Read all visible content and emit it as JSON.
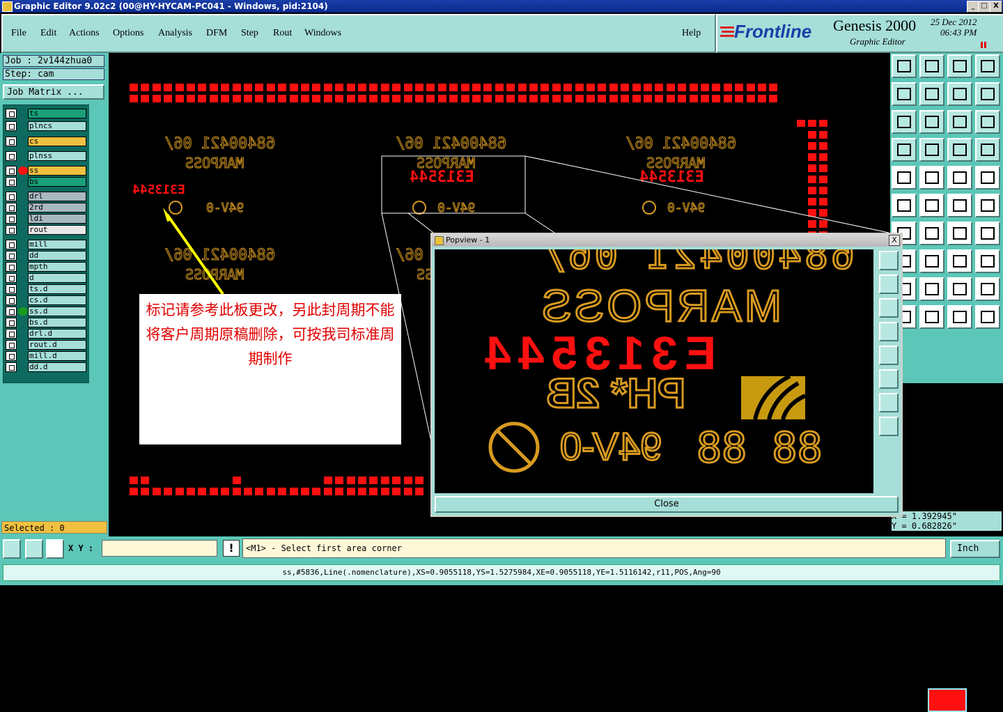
{
  "window": {
    "title": "Graphic Editor 9.02c2 (00@HY-HYCAM-PC041 - Windows, pid:2104)",
    "min_label": "_",
    "restore_label": "□",
    "close_label": "X"
  },
  "menu": {
    "items": [
      "File",
      "Edit",
      "Actions",
      "Options",
      "Analysis",
      "DFM",
      "Step",
      "Rout",
      "Windows"
    ],
    "help": "Help"
  },
  "brand": {
    "logo": "Frontline",
    "product": "Genesis 2000",
    "subtitle": "Graphic Editor",
    "date": "25 Dec 2012",
    "time": "06:43 PM"
  },
  "job": {
    "job_label": "Job : 2v144zhua0",
    "step_label": "Step: cam",
    "matrix_button": "Job Matrix ..."
  },
  "layers": [
    {
      "name": "ts",
      "color": "#1aa07a"
    },
    {
      "name": "plncs",
      "color": "#a6ded8"
    },
    {
      "name": "cs",
      "color": "#f0c040"
    },
    {
      "name": "plnss",
      "color": "#a6ded8"
    },
    {
      "name": "ss",
      "color": "#f0c040",
      "active": true
    },
    {
      "name": "bs",
      "color": "#1aa07a"
    },
    {
      "name": "drl",
      "color": "#a8b8c0"
    },
    {
      "name": "2rd",
      "color": "#a8b8c0"
    },
    {
      "name": "ldi",
      "color": "#a8b8c0"
    },
    {
      "name": "rout",
      "color": "#e8e8e8"
    },
    {
      "name": "mill",
      "color": "#a6ded8"
    },
    {
      "name": "dd",
      "color": "#a6ded8"
    },
    {
      "name": "mpth",
      "color": "#a6ded8"
    },
    {
      "name": "d",
      "color": "#a6ded8"
    },
    {
      "name": "ts.d",
      "color": "#a6ded8"
    },
    {
      "name": "cs.d",
      "color": "#a6ded8"
    },
    {
      "name": "ss.d",
      "color": "#a6ded8",
      "green": true
    },
    {
      "name": "bs.d",
      "color": "#a6ded8"
    },
    {
      "name": "drl.d",
      "color": "#a6ded8"
    },
    {
      "name": "rout.d",
      "color": "#a6ded8"
    },
    {
      "name": "mill.d",
      "color": "#a6ded8"
    },
    {
      "name": "dd.d",
      "color": "#a6ded8"
    }
  ],
  "selected": "Selected : 0",
  "canvas": {
    "part_number": "68400421 06/",
    "brand_text": "MARPOSS",
    "code": "E313544",
    "ph_text": "PH* 2B",
    "rating": "94V-0",
    "date_code": "88 88",
    "note": "标记请参考此板更改，另此封周期不能将客户周期原稿删除，可按我司标准周期制作"
  },
  "popview": {
    "title": "Popview - 1",
    "close_label": "Close",
    "x_label": "X"
  },
  "coords": {
    "x": "X = 1.392945\"",
    "y": "Y = 0.682826\""
  },
  "bottom": {
    "xy_label": "X Y :",
    "xy_value": "",
    "excl": "!",
    "prompt": "<M1> - Select first area corner",
    "units": "Inch"
  },
  "status": "ss,#5836,Line(.nomenclature),XS=0.9055118,YS=1.5275984,XE=0.9055118,YE=1.5116142,r11,POS,Ang=90",
  "colors": {
    "accent": "#5cc7b8",
    "panel": "#a6ded8",
    "pad_red": "#ff1010",
    "silk_orange": "#d89a20",
    "silk_green": "#4aa030",
    "note_red": "#e00000"
  }
}
